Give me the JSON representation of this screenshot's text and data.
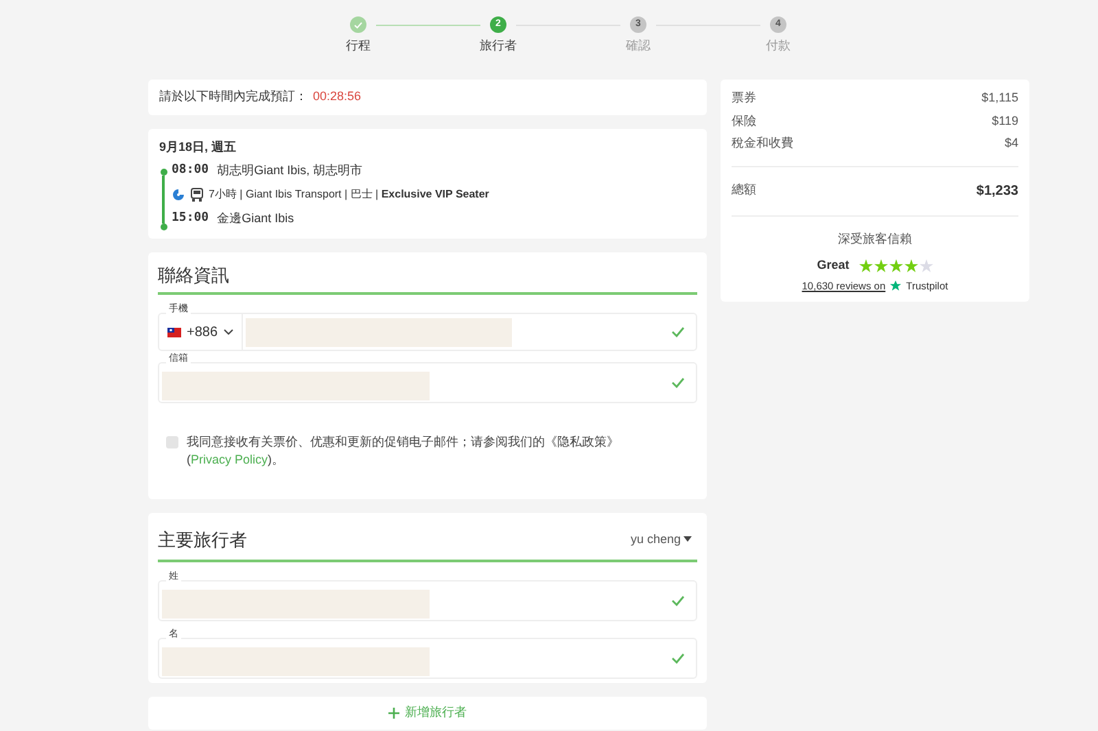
{
  "steps": [
    {
      "label": "行程",
      "completed": true,
      "selected": false
    },
    {
      "number": "2",
      "label": "旅行者",
      "completed": false,
      "selected": true
    },
    {
      "number": "3",
      "label": "確認",
      "completed": false,
      "selected": false
    },
    {
      "number": "4",
      "label": "付款",
      "completed": false,
      "selected": false
    }
  ],
  "timer": {
    "label": "請於以下時間內完成預訂：",
    "time": "00:28:56"
  },
  "trip": {
    "date": "9月18日, 週五",
    "departure": {
      "time": "08:00",
      "place": "胡志明Giant Ibis, 胡志明市"
    },
    "details": "7小時 | Giant Ibis Transport | 巴士 | **Exclusive VIP Seater**",
    "arrival": {
      "time": "15:00",
      "place": "金邊Giant Ibis"
    }
  },
  "contact": {
    "title": "聯絡資訊",
    "phone": {
      "label": "手機",
      "code": "+886",
      "valid": true
    },
    "email": {
      "label": "信箱",
      "valid": true
    },
    "consent": {
      "checked": false,
      "text": "我同意接收有关票价、优惠和更新的促销电子邮件；请参阅我们的《隐私政策》(",
      "link": "Privacy Policy",
      "after": ")。"
    }
  },
  "traveler": {
    "title": "主要旅行者",
    "selector": "yu cheng",
    "fields": [
      {
        "label": "姓",
        "valid": true
      },
      {
        "label": "名",
        "valid": true
      }
    ]
  },
  "add_traveler": "新增旅行者",
  "summary": {
    "lines": [
      {
        "label": "票券",
        "amount": "$1,115"
      },
      {
        "label": "保險",
        "amount": "$119"
      },
      {
        "label": "稅金和收費",
        "amount": "$4"
      }
    ],
    "total": {
      "label": "總額",
      "amount": "$1,233"
    },
    "trust": {
      "title": "深受旅客信賴",
      "rating": "Great",
      "stars": 4,
      "reviews": "10,630 reviews on",
      "brand": "Trustpilot"
    }
  }
}
